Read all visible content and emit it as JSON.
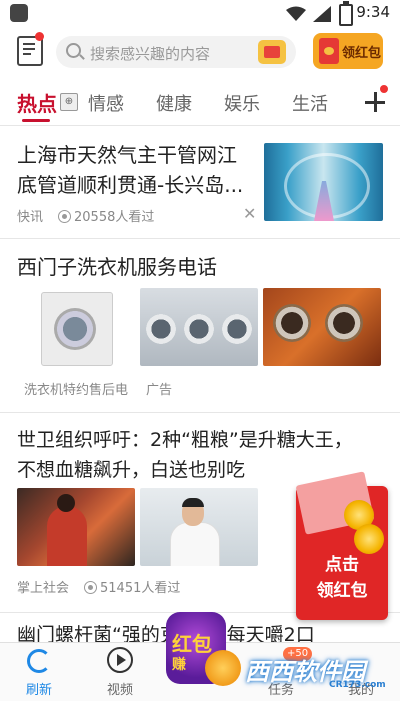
{
  "status_bar": {
    "time": "9:34"
  },
  "header": {
    "search_placeholder": "搜索感兴趣的内容",
    "red_packet_label": "领红包"
  },
  "tabs": [
    {
      "label": "热点",
      "active": true
    },
    {
      "label": "情感"
    },
    {
      "label": "健康"
    },
    {
      "label": "娱乐"
    },
    {
      "label": "生活"
    }
  ],
  "articles": [
    {
      "title_line1": "上海市天然气主干管网江",
      "title_line2": "底管道顺利贯通-长兴岛...",
      "source": "快讯",
      "views": "20558人看过"
    },
    {
      "title": "西门子洗衣机服务电话",
      "source": "洗衣机特约售后电",
      "ad_label": "广告"
    },
    {
      "title_line1": "世卫组织呼吁：2种“粗粮”是升糖大王，",
      "title_line2": "不想血糖飙升，白送也别吃",
      "source": "掌上社会",
      "views": "51451人看过"
    },
    {
      "title_partial": "幽门螺杆菌“强的克星”，每天嚼2口"
    }
  ],
  "floating_promo": {
    "line1": "点击",
    "line2": "领红包"
  },
  "promo_badge": {
    "line1": "红包",
    "line2": "赚"
  },
  "bottom_nav": [
    {
      "label": "刷新",
      "active": true
    },
    {
      "label": "视频"
    },
    {
      "label": "任务",
      "badge": "+50"
    },
    {
      "label": "我的"
    }
  ],
  "watermark": {
    "text": "西西软件园",
    "url": "CR173.com"
  },
  "colors": {
    "accent": "#c8102e",
    "nav_active": "#1e88e5"
  }
}
